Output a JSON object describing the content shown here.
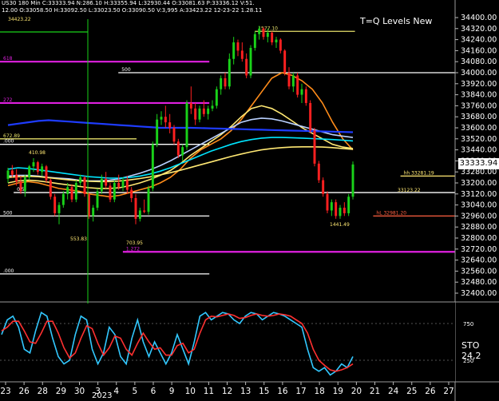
{
  "header": {
    "line1": "US30  180 Min   C:33333.94  N:286.10  H:33355.94  L:32930.44  O:33081.63  P:33336.12  V:51.",
    "line2": "12.00  O:33058.50  H:33092.50  L:33023.50  O:33090.50  V:3,995  A:33423.22  12-23-22  1.28.11"
  },
  "chart_data": [
    {
      "type": "line",
      "title": "T=Q Levels New",
      "current_price": "33333.94",
      "ylim": [
        32400,
        34400
      ],
      "yticks": [
        "34400.00",
        "34320.00",
        "34240.00",
        "34160.00",
        "34080.00",
        "34000.00",
        "33920.00",
        "33840.00",
        "33760.00",
        "33680.00",
        "33600.00",
        "33520.00",
        "33440.00",
        "33360.00",
        "33280.00",
        "33200.00",
        "33120.00",
        "33040.00",
        "32960.00",
        "32880.00",
        "32800.00",
        "32720.00",
        "32640.00",
        "32560.00",
        "32480.00",
        "32400.00"
      ],
      "candles": [
        {
          "o": 33230,
          "h": 33310,
          "l": 33200,
          "c": 33290
        },
        {
          "o": 33290,
          "h": 33330,
          "l": 33240,
          "c": 33260
        },
        {
          "o": 33260,
          "h": 33300,
          "l": 33180,
          "c": 33210
        },
        {
          "o": 33210,
          "h": 33250,
          "l": 33120,
          "c": 33140
        },
        {
          "o": 33140,
          "h": 33260,
          "l": 33100,
          "c": 33240
        },
        {
          "o": 33240,
          "h": 33330,
          "l": 33220,
          "c": 33320
        },
        {
          "o": 33320,
          "h": 33380,
          "l": 33280,
          "c": 33350
        },
        {
          "o": 33350,
          "h": 33360,
          "l": 33260,
          "c": 33280
        },
        {
          "o": 33280,
          "h": 33340,
          "l": 33250,
          "c": 33320
        },
        {
          "o": 33320,
          "h": 33330,
          "l": 33200,
          "c": 33220
        },
        {
          "o": 33220,
          "h": 33230,
          "l": 33080,
          "c": 33100
        },
        {
          "o": 33100,
          "h": 33120,
          "l": 32960,
          "c": 32980
        },
        {
          "o": 32980,
          "h": 33060,
          "l": 32900,
          "c": 33040
        },
        {
          "o": 33040,
          "h": 33140,
          "l": 33020,
          "c": 33120
        },
        {
          "o": 33120,
          "h": 33200,
          "l": 33080,
          "c": 33170
        },
        {
          "o": 33170,
          "h": 33190,
          "l": 33060,
          "c": 33080
        },
        {
          "o": 33080,
          "h": 33220,
          "l": 33060,
          "c": 33200
        },
        {
          "o": 33200,
          "h": 33260,
          "l": 33180,
          "c": 33240
        },
        {
          "o": 33240,
          "h": 33250,
          "l": 33100,
          "c": 33120
        },
        {
          "o": 33120,
          "h": 33130,
          "l": 32940,
          "c": 32960
        },
        {
          "o": 32960,
          "h": 33040,
          "l": 32920,
          "c": 33020
        },
        {
          "o": 33020,
          "h": 33160,
          "l": 33000,
          "c": 33140
        },
        {
          "o": 33140,
          "h": 33260,
          "l": 33120,
          "c": 33230
        },
        {
          "o": 33230,
          "h": 33280,
          "l": 33160,
          "c": 33180
        },
        {
          "o": 33180,
          "h": 33200,
          "l": 33060,
          "c": 33080
        },
        {
          "o": 33080,
          "h": 33220,
          "l": 33060,
          "c": 33200
        },
        {
          "o": 33200,
          "h": 33260,
          "l": 33150,
          "c": 33170
        },
        {
          "o": 33170,
          "h": 33240,
          "l": 33140,
          "c": 33220
        },
        {
          "o": 33220,
          "h": 33250,
          "l": 33120,
          "c": 33150
        },
        {
          "o": 33150,
          "h": 33170,
          "l": 33060,
          "c": 33090
        },
        {
          "o": 33090,
          "h": 33120,
          "l": 32900,
          "c": 32940
        },
        {
          "o": 32940,
          "h": 33020,
          "l": 32920,
          "c": 33000
        },
        {
          "o": 33000,
          "h": 33080,
          "l": 32980,
          "c": 32990
        },
        {
          "o": 32990,
          "h": 33180,
          "l": 32970,
          "c": 33160
        },
        {
          "o": 33160,
          "h": 33500,
          "l": 33140,
          "c": 33480
        },
        {
          "o": 33480,
          "h": 33700,
          "l": 33460,
          "c": 33660
        },
        {
          "o": 33660,
          "h": 33720,
          "l": 33620,
          "c": 33680
        },
        {
          "o": 33680,
          "h": 33760,
          "l": 33600,
          "c": 33640
        },
        {
          "o": 33640,
          "h": 33700,
          "l": 33560,
          "c": 33600
        },
        {
          "o": 33600,
          "h": 33620,
          "l": 33480,
          "c": 33500
        },
        {
          "o": 33500,
          "h": 33520,
          "l": 33380,
          "c": 33400
        },
        {
          "o": 33400,
          "h": 33480,
          "l": 33360,
          "c": 33460
        },
        {
          "o": 33460,
          "h": 33800,
          "l": 33440,
          "c": 33780
        },
        {
          "o": 33780,
          "h": 33900,
          "l": 33700,
          "c": 33740
        },
        {
          "o": 33740,
          "h": 33780,
          "l": 33620,
          "c": 33660
        },
        {
          "o": 33660,
          "h": 33760,
          "l": 33640,
          "c": 33740
        },
        {
          "o": 33740,
          "h": 33800,
          "l": 33680,
          "c": 33700
        },
        {
          "o": 33700,
          "h": 33760,
          "l": 33660,
          "c": 33740
        },
        {
          "o": 33740,
          "h": 33800,
          "l": 33720,
          "c": 33760
        },
        {
          "o": 33760,
          "h": 33900,
          "l": 33740,
          "c": 33880
        },
        {
          "o": 33880,
          "h": 33980,
          "l": 33840,
          "c": 33960
        },
        {
          "o": 33960,
          "h": 34000,
          "l": 33880,
          "c": 33900
        },
        {
          "o": 33900,
          "h": 34140,
          "l": 33880,
          "c": 34100
        },
        {
          "o": 34100,
          "h": 34260,
          "l": 34060,
          "c": 34220
        },
        {
          "o": 34220,
          "h": 34240,
          "l": 34120,
          "c": 34160
        },
        {
          "o": 34160,
          "h": 34220,
          "l": 34080,
          "c": 34100
        },
        {
          "o": 34100,
          "h": 34140,
          "l": 33960,
          "c": 33980
        },
        {
          "o": 33980,
          "h": 34200,
          "l": 33960,
          "c": 34180
        },
        {
          "o": 34180,
          "h": 34300,
          "l": 34160,
          "c": 34280
        },
        {
          "o": 34280,
          "h": 34340,
          "l": 34240,
          "c": 34320
        },
        {
          "o": 34320,
          "h": 34330,
          "l": 34240,
          "c": 34260
        },
        {
          "o": 34260,
          "h": 34320,
          "l": 34220,
          "c": 34290
        },
        {
          "o": 34290,
          "h": 34300,
          "l": 34200,
          "c": 34220
        },
        {
          "o": 34220,
          "h": 34260,
          "l": 34180,
          "c": 34240
        },
        {
          "o": 34240,
          "h": 34250,
          "l": 34140,
          "c": 34160
        },
        {
          "o": 34160,
          "h": 34170,
          "l": 33980,
          "c": 34000
        },
        {
          "o": 34000,
          "h": 34040,
          "l": 33880,
          "c": 33900
        },
        {
          "o": 33900,
          "h": 34000,
          "l": 33860,
          "c": 33980
        },
        {
          "o": 33980,
          "h": 34000,
          "l": 33820,
          "c": 33840
        },
        {
          "o": 33840,
          "h": 33920,
          "l": 33780,
          "c": 33880
        },
        {
          "o": 33880,
          "h": 33900,
          "l": 33760,
          "c": 33780
        },
        {
          "o": 33780,
          "h": 33800,
          "l": 33560,
          "c": 33580
        },
        {
          "o": 33580,
          "h": 33600,
          "l": 33320,
          "c": 33340
        },
        {
          "o": 33340,
          "h": 33360,
          "l": 33200,
          "c": 33220
        },
        {
          "o": 33220,
          "h": 33240,
          "l": 33100,
          "c": 33120
        },
        {
          "o": 33120,
          "h": 33140,
          "l": 32980,
          "c": 33000
        },
        {
          "o": 33000,
          "h": 33080,
          "l": 32960,
          "c": 33060
        },
        {
          "o": 33060,
          "h": 33080,
          "l": 32940,
          "c": 32960
        },
        {
          "o": 32960,
          "h": 33040,
          "l": 32940,
          "c": 33020
        },
        {
          "o": 33020,
          "h": 33060,
          "l": 32960,
          "c": 32980
        },
        {
          "o": 32980,
          "h": 33120,
          "l": 32960,
          "c": 33100
        },
        {
          "o": 33100,
          "h": 33356,
          "l": 33080,
          "c": 33334
        }
      ],
      "moving_averages": [
        {
          "color": "#ff8c1a",
          "values": [
            33180,
            33200,
            33210,
            33200,
            33180,
            33160,
            33150,
            33140,
            33120,
            33110,
            33100,
            33110,
            33130,
            33150,
            33170,
            33200,
            33240,
            33300,
            33380,
            33440,
            33480,
            33520,
            33580,
            33660,
            33760,
            33860,
            33960,
            34000,
            33980,
            33940,
            33880,
            33780,
            33640,
            33520,
            33440
          ]
        },
        {
          "color": "#ffe873",
          "values": [
            33200,
            33215,
            33220,
            33215,
            33205,
            33195,
            33185,
            33175,
            33165,
            33160,
            33160,
            33165,
            33180,
            33200,
            33225,
            33255,
            33290,
            33340,
            33400,
            33450,
            33500,
            33550,
            33610,
            33680,
            33740,
            33760,
            33740,
            33700,
            33650,
            33600,
            33560,
            33520,
            33480,
            33460,
            33450
          ]
        },
        {
          "color": "#b9d0ff",
          "values": [
            33250,
            33255,
            33255,
            33250,
            33240,
            33235,
            33230,
            33220,
            33215,
            33215,
            33220,
            33230,
            33250,
            33270,
            33295,
            33325,
            33360,
            33400,
            33440,
            33480,
            33520,
            33560,
            33600,
            33640,
            33660,
            33670,
            33665,
            33650,
            33630,
            33610,
            33590,
            33570,
            33550,
            33540,
            33530
          ]
        },
        {
          "color": "#00e5ff",
          "values": [
            33300,
            33310,
            33305,
            33295,
            33285,
            33275,
            33265,
            33255,
            33245,
            33240,
            33235,
            33235,
            33240,
            33250,
            33265,
            33285,
            33310,
            33340,
            33370,
            33400,
            33430,
            33455,
            33480,
            33500,
            33515,
            33525,
            33530,
            33530,
            33528,
            33525,
            33522,
            33518,
            33515,
            33510,
            33505
          ]
        },
        {
          "color": "#1e3cff",
          "values": [
            33620,
            33630,
            33640,
            33650,
            33655,
            33650,
            33645,
            33640,
            33635,
            33630,
            33625,
            33620,
            33615,
            33610,
            33605,
            33600,
            33600,
            33600,
            33600,
            33598,
            33596,
            33594,
            33592,
            33590,
            33588,
            33586,
            33584,
            33582,
            33580,
            33578,
            33576,
            33574,
            33572,
            33570,
            33568
          ]
        },
        {
          "color": "#ffe873",
          "values": [
            33240,
            33245,
            33248,
            33245,
            33238,
            33230,
            33222,
            33216,
            33212,
            33210,
            33210,
            33214,
            33222,
            33232,
            33244,
            33258,
            33274,
            33292,
            33312,
            33332,
            33352,
            33372,
            33392,
            33410,
            33426,
            33440,
            33450,
            33456,
            33460,
            33462,
            33462,
            33460,
            33456,
            33450,
            33444
          ]
        }
      ],
      "levels": [
        {
          "color": "#e020e0",
          "value": 34080,
          "from": 0.0,
          "to": 0.46,
          "label": "618"
        },
        {
          "color": "#e020e0",
          "value": 33780,
          "from": 0.0,
          "to": 0.46,
          "label": "272"
        },
        {
          "color": "#e020e0",
          "value": 32700,
          "from": 0.27,
          "to": 1.0,
          "label": "1.272"
        },
        {
          "color": "#e6e06a",
          "value": 34300,
          "from": 0.56,
          "to": 0.78,
          "label": "1577.10"
        },
        {
          "color": "#e6e06a",
          "value": 33520,
          "from": 0.0,
          "to": 0.3,
          "label": "672.89"
        },
        {
          "color": "#ffffff",
          "value": 34000,
          "from": 0.26,
          "to": 1.0,
          "label": "500"
        },
        {
          "color": "#ffffff",
          "value": 33480,
          "from": 0.0,
          "to": 0.46,
          "label": ".000"
        },
        {
          "color": "#ffffff",
          "value": 33130,
          "from": 0.03,
          "to": 1.0,
          "label": "0.5"
        },
        {
          "color": "#ffffff",
          "value": 32960,
          "from": 0.0,
          "to": 0.46,
          "label": "500"
        },
        {
          "color": "#ffffff",
          "value": 32540,
          "from": 0.0,
          "to": 0.46,
          "label": ".000"
        },
        {
          "color": "#ffe873",
          "value": 33250,
          "from": 0.88,
          "to": 1.0,
          "label": "hh 33281.19"
        },
        {
          "color": "#ff6040",
          "value": 32960,
          "from": 0.82,
          "to": 1.0,
          "label": "hL 32981.20"
        }
      ],
      "annotations": [
        "410.98",
        "553.83",
        "703.95",
        "1441.49",
        "33123.22",
        "34423.22"
      ],
      "x_labels": [
        "23",
        "26",
        "28",
        "29",
        "30",
        "3",
        "4",
        "5",
        "6",
        "9",
        "10",
        "11",
        "12",
        "13",
        "15",
        "16",
        "17",
        "18",
        "19",
        "20",
        "21",
        "24",
        "25",
        "26",
        "27"
      ],
      "x_year": "2023"
    },
    {
      "type": "line",
      "title": "STO",
      "indicator_value": "24,2",
      "ylim": [
        0,
        100
      ],
      "yticks": [
        "250",
        "750"
      ],
      "series": [
        {
          "color": "#32c8ff",
          "values": [
            60,
            80,
            85,
            70,
            40,
            35,
            65,
            90,
            85,
            55,
            30,
            20,
            25,
            60,
            85,
            80,
            40,
            20,
            35,
            70,
            60,
            30,
            20,
            55,
            80,
            50,
            30,
            50,
            35,
            20,
            35,
            60,
            40,
            20,
            50,
            85,
            90,
            80,
            85,
            90,
            88,
            80,
            75,
            85,
            90,
            88,
            80,
            85,
            90,
            88,
            85,
            80,
            75,
            70,
            40,
            15,
            10,
            15,
            5,
            10,
            20,
            15,
            30
          ]
        },
        {
          "color": "#ff3030",
          "values": [
            65,
            70,
            78,
            78,
            65,
            50,
            48,
            62,
            78,
            78,
            62,
            42,
            28,
            35,
            55,
            72,
            68,
            48,
            32,
            42,
            58,
            55,
            40,
            32,
            48,
            62,
            50,
            40,
            42,
            32,
            32,
            45,
            48,
            35,
            40,
            62,
            80,
            85,
            84,
            86,
            88,
            86,
            82,
            83,
            86,
            88,
            86,
            85,
            86,
            88,
            87,
            85,
            80,
            75,
            62,
            40,
            25,
            18,
            12,
            10,
            12,
            15,
            20
          ]
        }
      ]
    }
  ]
}
